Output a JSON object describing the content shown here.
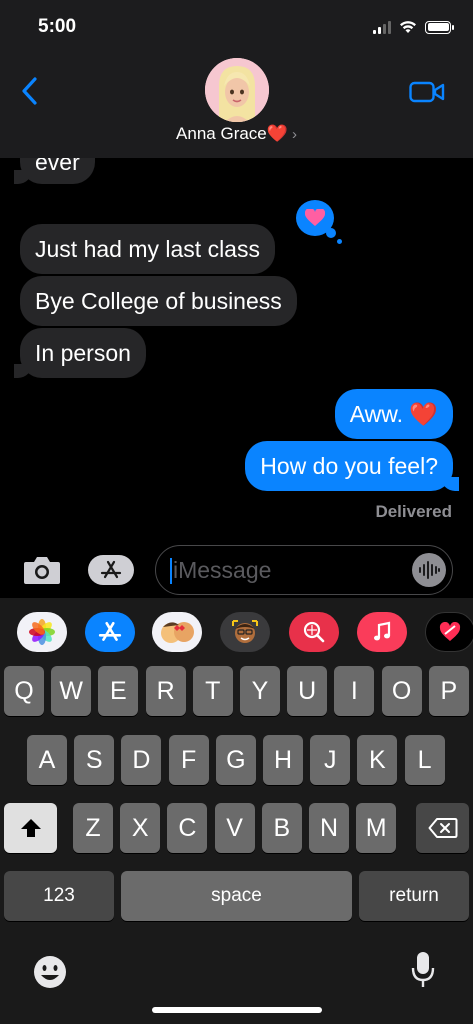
{
  "status_bar": {
    "time": "5:00"
  },
  "header": {
    "contact_name": "Anna Grace",
    "contact_heart": "❤️",
    "contact_chevron": "›"
  },
  "messages": [
    {
      "from": "them",
      "text": "ever"
    },
    {
      "from": "them",
      "text": "Just had my last class",
      "tapback": "heart"
    },
    {
      "from": "them",
      "text": "Bye College of business"
    },
    {
      "from": "them",
      "text": "In person"
    },
    {
      "from": "me",
      "text": "Aww. ❤️"
    },
    {
      "from": "me",
      "text": "How do you feel?"
    }
  ],
  "delivery_status": "Delivered",
  "composer": {
    "placeholder": "iMessage"
  },
  "app_strip": [
    "photos-icon",
    "app-store-icon",
    "memoji-stickers-icon",
    "animoji-icon",
    "search-images-icon",
    "music-icon",
    "digital-touch-icon"
  ],
  "keyboard": {
    "row1": [
      "Q",
      "W",
      "E",
      "R",
      "T",
      "Y",
      "U",
      "I",
      "O",
      "P"
    ],
    "row2": [
      "A",
      "S",
      "D",
      "F",
      "G",
      "H",
      "J",
      "K",
      "L"
    ],
    "row3": [
      "Z",
      "X",
      "C",
      "V",
      "B",
      "N",
      "M"
    ],
    "numbers_key": "123",
    "space_key": "space",
    "return_key": "return"
  },
  "colors": {
    "accent": "#0a84ff",
    "incoming_bubble": "#262628",
    "background": "#000000",
    "header": "#1c1c1e"
  }
}
